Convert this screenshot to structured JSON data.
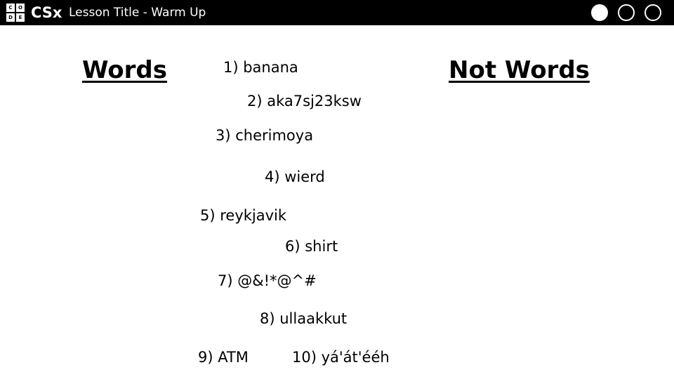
{
  "header": {
    "logo_letters": [
      "C",
      "O",
      "D",
      "E"
    ],
    "brand": "CSx",
    "lesson_title": "Lesson Title - Warm Up",
    "progress_dots": 3,
    "progress_completed": 1
  },
  "columns": {
    "words_heading": "Words",
    "not_words_heading": "Not Words"
  },
  "items": [
    "1) banana",
    "2) aka7sj23ksw",
    "3) cherimoya",
    "4) wierd",
    "5) reykjavik",
    "6) shirt",
    "7) @&!*@^#",
    "8) ullaakkut",
    "9) ATM",
    "10) yá'át'ééh"
  ]
}
